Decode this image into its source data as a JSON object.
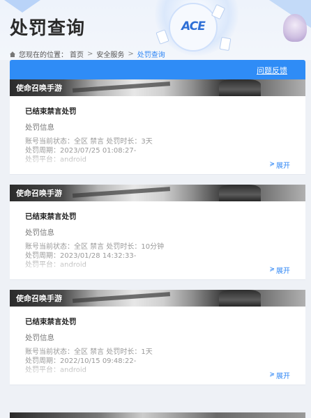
{
  "header": {
    "title": "处罚查询",
    "logo_text": "ACE"
  },
  "breadcrumb": {
    "prefix": "您现在的位置：",
    "items": [
      "首页",
      "安全服务",
      "处罚查询"
    ],
    "separator": ">"
  },
  "action_bar": {
    "feedback_label": "问题反馈",
    "accent_color": "#2f8cf6"
  },
  "records": [
    {
      "game": "使命召唤手游",
      "status": "已结束禁言处罚",
      "subtitle": "处罚信息",
      "details": [
        "账号当前状态：全区 禁言  处罚时长：3天",
        "处罚周期：2023/07/25 01:08:27-",
        "处罚平台：android"
      ],
      "expand_label": "展开"
    },
    {
      "game": "使命召唤手游",
      "status": "已结束禁言处罚",
      "subtitle": "处罚信息",
      "details": [
        "账号当前状态：全区 禁言  处罚时长：10分钟",
        "处罚周期：2023/01/28 14:32:33-",
        "处罚平台：android"
      ],
      "expand_label": "展开"
    },
    {
      "game": "使命召唤手游",
      "status": "已结束禁言处罚",
      "subtitle": "处罚信息",
      "details": [
        "账号当前状态：全区 禁言  处罚时长：1天",
        "处罚周期：2022/10/15 09:48:22-",
        "处罚平台：android"
      ],
      "expand_label": "展开"
    }
  ],
  "icons": {
    "home": "home-icon",
    "expand": "chevron-down-icon"
  }
}
